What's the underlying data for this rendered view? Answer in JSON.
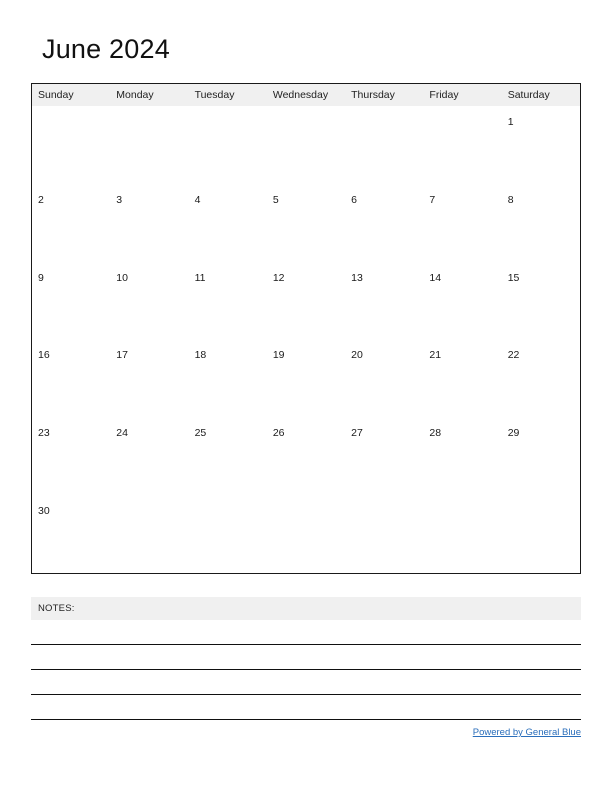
{
  "document": {
    "title": "June 2024",
    "month": "June",
    "year": "2024"
  },
  "calendar": {
    "weekday_headers": [
      "Sunday",
      "Monday",
      "Tuesday",
      "Wednesday",
      "Thursday",
      "Friday",
      "Saturday"
    ],
    "weeks": [
      [
        "",
        "",
        "",
        "",
        "",
        "",
        "1"
      ],
      [
        "2",
        "3",
        "4",
        "5",
        "6",
        "7",
        "8"
      ],
      [
        "9",
        "10",
        "11",
        "12",
        "13",
        "14",
        "15"
      ],
      [
        "16",
        "17",
        "18",
        "19",
        "20",
        "21",
        "22"
      ],
      [
        "23",
        "24",
        "25",
        "26",
        "27",
        "28",
        "29"
      ],
      [
        "30",
        "",
        "",
        "",
        "",
        "",
        ""
      ]
    ]
  },
  "notes": {
    "label": "NOTES:",
    "line_count": 4
  },
  "footer": {
    "link_text": "Powered by General Blue"
  },
  "colors": {
    "header_background": "#f0f0f0",
    "grid_border": "#1a1a1a",
    "text": "#1a1a1a",
    "link": "#2a6ebb",
    "page_background": "#ffffff"
  }
}
